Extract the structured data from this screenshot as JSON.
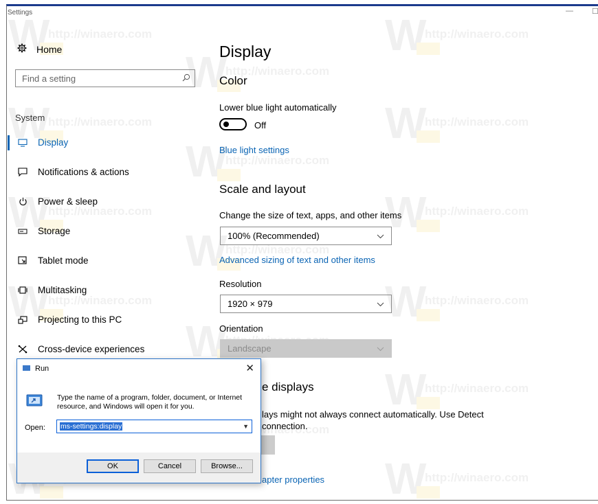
{
  "window": {
    "title": "Settings",
    "minimize": "—",
    "maximize": "☐"
  },
  "sidebar": {
    "home_label": "Home",
    "search_placeholder": "Find a setting",
    "section_label": "System",
    "items": [
      {
        "label": "Display",
        "icon": "monitor-icon"
      },
      {
        "label": "Notifications & actions",
        "icon": "notification-icon"
      },
      {
        "label": "Power & sleep",
        "icon": "power-icon"
      },
      {
        "label": "Storage",
        "icon": "storage-icon"
      },
      {
        "label": "Tablet mode",
        "icon": "tablet-icon"
      },
      {
        "label": "Multitasking",
        "icon": "multitasking-icon"
      },
      {
        "label": "Projecting to this PC",
        "icon": "projecting-icon"
      },
      {
        "label": "Cross-device experiences",
        "icon": "cross-device-icon"
      }
    ]
  },
  "main": {
    "title": "Display",
    "color_heading": "Color",
    "night_light_label": "Lower blue light automatically",
    "toggle_state": "Off",
    "blue_light_link": "Blue light settings",
    "scale_heading": "Scale and layout",
    "scale_label": "Change the size of text, apps, and other items",
    "scale_value": "100% (Recommended)",
    "advanced_link": "Advanced sizing of text and other items",
    "resolution_label": "Resolution",
    "resolution_value": "1920 × 979",
    "orientation_label": "Orientation",
    "orientation_value": "Landscape",
    "displays_heading_partial": "e displays",
    "displays_text_line1": "lays might not always connect automatically. Use Detect",
    "displays_text_line2": "connection.",
    "adapter_link_partial": "apter properties"
  },
  "run_dialog": {
    "title": "Run",
    "description": "Type the name of a program, folder, document, or Internet resource, and Windows will open it for you.",
    "open_label": "Open:",
    "input_value": "ms-settings:display",
    "ok_label": "OK",
    "cancel_label": "Cancel",
    "browse_label": "Browse..."
  },
  "watermark": {
    "text": "http://winaero.com",
    "letter": "W"
  },
  "colors": {
    "accent": "#0a64b4",
    "title_bar": "#1b3a8c",
    "run_border": "#2b73c6"
  }
}
